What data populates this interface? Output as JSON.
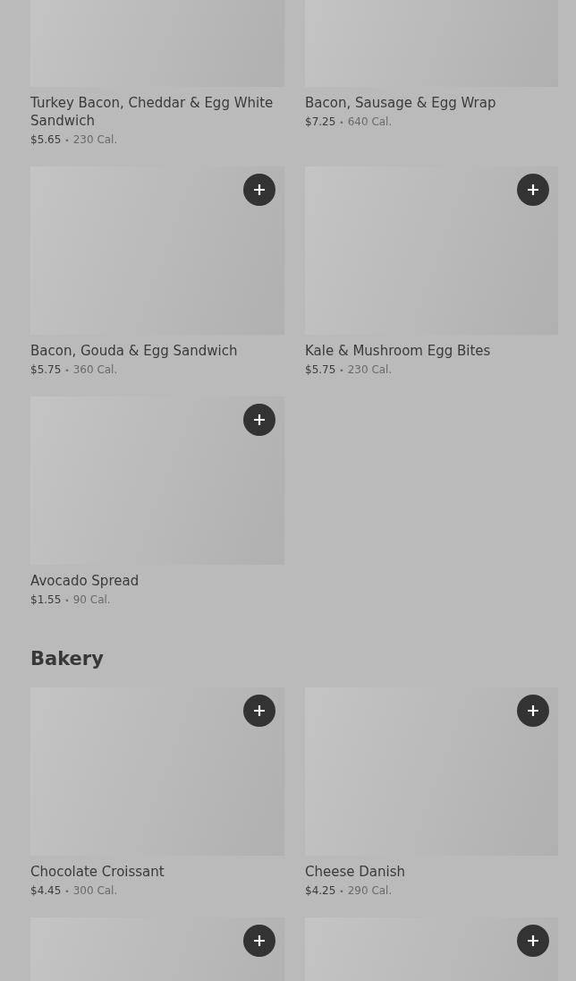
{
  "sections": [
    {
      "items": [
        {
          "cropped": true,
          "name": "Turkey Bacon, Cheddar & Egg White Sandwich",
          "price": "$5.65",
          "separator": "•",
          "calories": "230 Cal."
        },
        {
          "cropped": true,
          "name": "Bacon, Sausage & Egg Wrap",
          "price": "$7.25",
          "separator": "•",
          "calories": "640 Cal."
        },
        {
          "cropped": false,
          "name": "Bacon, Gouda & Egg Sandwich",
          "price": "$5.75",
          "separator": "•",
          "calories": "360 Cal."
        },
        {
          "cropped": false,
          "name": "Kale & Mushroom Egg Bites",
          "price": "$5.75",
          "separator": "•",
          "calories": "230 Cal."
        },
        {
          "cropped": false,
          "name": "Avocado Spread",
          "price": "$1.55",
          "separator": "•",
          "calories": "90 Cal."
        }
      ]
    },
    {
      "title": "Bakery",
      "items": [
        {
          "cropped": false,
          "name": "Chocolate Croissant",
          "price": "$4.45",
          "separator": "•",
          "calories": "300 Cal."
        },
        {
          "cropped": false,
          "name": "Cheese Danish",
          "price": "$4.25",
          "separator": "•",
          "calories": "290 Cal."
        },
        {
          "cropped": false
        },
        {
          "cropped": false
        }
      ]
    }
  ]
}
